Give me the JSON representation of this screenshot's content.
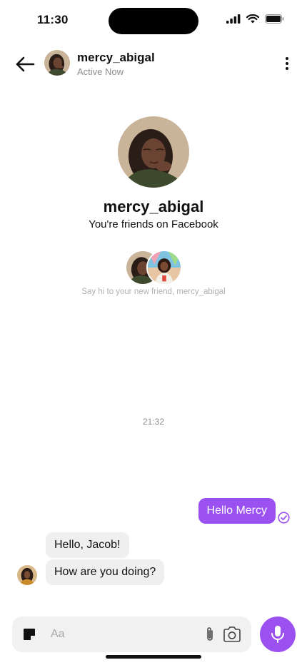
{
  "status_bar": {
    "time": "11:30"
  },
  "header": {
    "name": "mercy_abigal",
    "status": "Active Now"
  },
  "intro": {
    "name": "mercy_abigal",
    "subtitle": "You're friends on Facebook",
    "hint": "Say hi to your new friend, mercy_abigal"
  },
  "conversation": {
    "timestamp": "21:32",
    "messages": [
      {
        "from": "me",
        "text": "Hello Mercy"
      },
      {
        "from": "them",
        "text": "Hello, Jacob!"
      },
      {
        "from": "them",
        "text": "How are you doing?"
      }
    ]
  },
  "composer": {
    "placeholder": "Aa"
  },
  "colors": {
    "accent": "#9b50f0",
    "incoming_bubble": "#efefef",
    "muted": "#8c8c8c"
  },
  "icons": [
    "signal-icon",
    "wifi-icon",
    "battery-icon",
    "back-arrow-icon",
    "more-vertical-icon",
    "seen-check-icon",
    "sticker-icon",
    "paperclip-icon",
    "camera-icon",
    "microphone-icon"
  ]
}
